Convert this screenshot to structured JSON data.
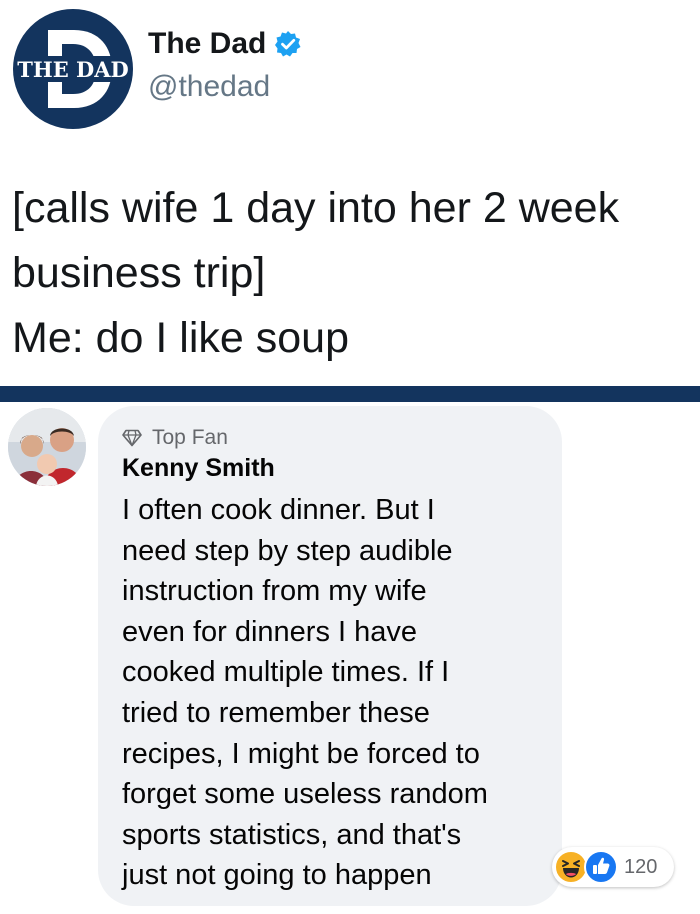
{
  "tweet": {
    "logo_text": "THE DAD",
    "author_name": "The Dad",
    "author_handle": "@thedad",
    "text_lines": [
      "[calls wife 1 day into her 2 week",
      "business trip]",
      "Me: do I like soup"
    ],
    "verified_icon": "verified-check-icon"
  },
  "colors": {
    "brand_navy": "#13345e",
    "verified_blue": "#1da1f2",
    "like_blue": "#1877f2",
    "haha_yellow": "#f7b125",
    "bubble_gray": "#f0f2f5"
  },
  "comment": {
    "badge_icon": "diamond-icon",
    "badge_label": "Top Fan",
    "author_name": "Kenny Smith",
    "body_lines": [
      "I often cook dinner.  But I",
      "need step by step audible",
      "instruction from my wife",
      "even for dinners I have",
      "cooked multiple times.  If I",
      "tried to remember these",
      "recipes, I might be forced to",
      "forget some useless random",
      "sports statistics, and that's",
      "just not going to happen"
    ],
    "reactions": {
      "icons": [
        "haha-icon",
        "like-icon"
      ],
      "count": "120"
    }
  }
}
